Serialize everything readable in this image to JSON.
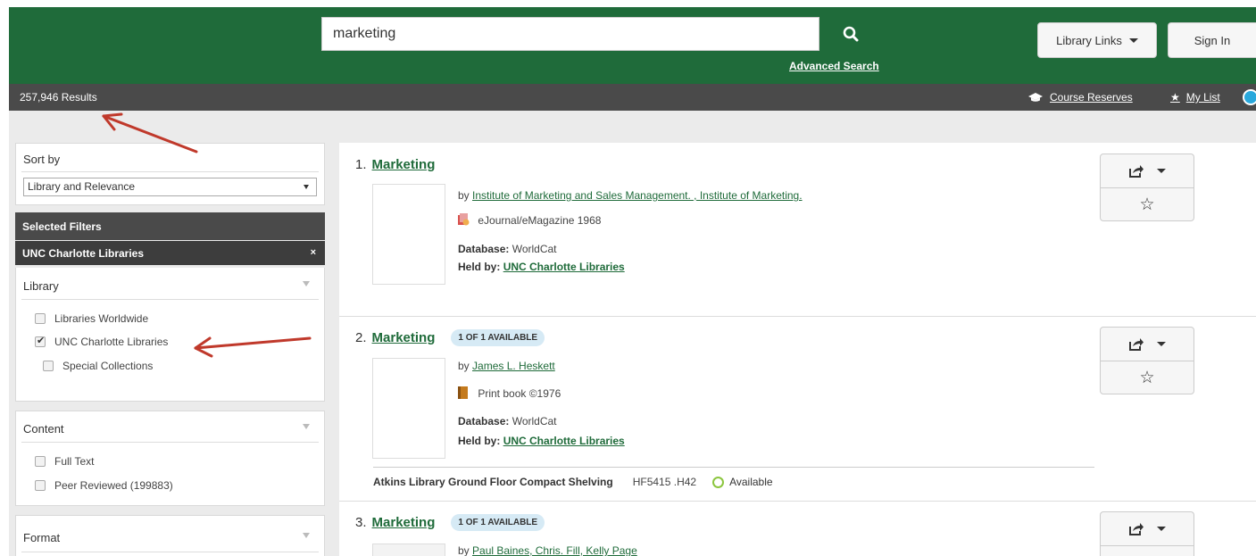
{
  "header": {
    "search_value": "marketing",
    "advanced_search": "Advanced Search",
    "library_links": "Library Links",
    "sign_in": "Sign In",
    "brand_color": "#1f6b3a"
  },
  "results_bar": {
    "count": "257,946 Results",
    "course_reserves": "Course Reserves",
    "my_list": "My List"
  },
  "sidebar": {
    "sort_by_label": "Sort by",
    "sort_value": "Library and Relevance",
    "selected_filters_label": "Selected Filters",
    "active_filter": "UNC Charlotte Libraries",
    "remove_filter": "×",
    "library_facet": {
      "title": "Library",
      "options": [
        {
          "label": "Libraries Worldwide",
          "checked": false
        },
        {
          "label": "UNC Charlotte Libraries",
          "checked": true
        },
        {
          "label": "Special Collections",
          "checked": false
        }
      ]
    },
    "content_facet": {
      "title": "Content",
      "options": [
        {
          "label": "Full Text",
          "checked": false
        },
        {
          "label": "Peer Reviewed (199883)",
          "checked": false
        }
      ]
    },
    "format_facet": {
      "title": "Format"
    }
  },
  "results": [
    {
      "number": "1.",
      "title": "Marketing",
      "by_prefix": "by",
      "authors": "Institute of Marketing and Sales Management. , Institute of Marketing.",
      "format": "eJournal/eMagazine 1968",
      "database_label": "Database:",
      "database": "WorldCat",
      "held_label": "Held by:",
      "held_by": "UNC Charlotte Libraries"
    },
    {
      "number": "2.",
      "title": "Marketing",
      "availability": "1 OF 1 AVAILABLE",
      "by_prefix": "by",
      "authors": "James L. Heskett",
      "format": "Print book ©1976",
      "database_label": "Database:",
      "database": "WorldCat",
      "held_label": "Held by:",
      "held_by": "UNC Charlotte Libraries",
      "holding": {
        "location": "Atkins Library Ground Floor Compact Shelving",
        "call_number": "HF5415 .H42",
        "status": "Available"
      }
    },
    {
      "number": "3.",
      "title": "Marketing",
      "availability": "1 OF 1 AVAILABLE",
      "by_prefix": "by",
      "authors": "Paul Baines, Chris. Fill, Kelly Page"
    }
  ]
}
